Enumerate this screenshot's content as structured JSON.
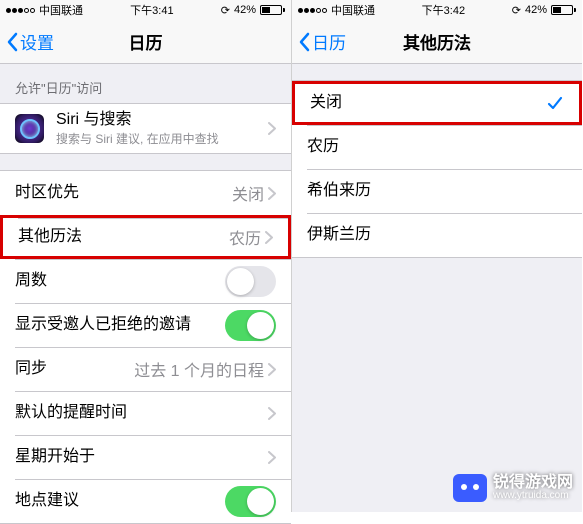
{
  "left": {
    "status": {
      "carrier": "中国联通",
      "time": "下午3:41",
      "battery": "42%"
    },
    "nav": {
      "back": "设置",
      "title": "日历"
    },
    "sectionHeader": "允许\"日历\"访问",
    "siri": {
      "title": "Siri 与搜索",
      "sub": "搜索与 Siri 建议, 在应用中查找"
    },
    "rows": {
      "tzOverride": {
        "label": "时区优先",
        "value": "关闭"
      },
      "altCal": {
        "label": "其他历法",
        "value": "农历"
      },
      "weekNum": {
        "label": "周数"
      },
      "declined": {
        "label": "显示受邀人已拒绝的邀请"
      },
      "sync": {
        "label": "同步",
        "value": "过去 1 个月的日程"
      },
      "alertTime": {
        "label": "默认的提醒时间"
      },
      "weekStart": {
        "label": "星期开始于"
      },
      "location": {
        "label": "地点建议"
      }
    }
  },
  "right": {
    "status": {
      "carrier": "中国联通",
      "time": "下午3:42",
      "battery": "42%"
    },
    "nav": {
      "back": "日历",
      "title": "其他历法"
    },
    "options": {
      "off": "关闭",
      "lunar": "农历",
      "hebrew": "希伯来历",
      "islamic": "伊斯兰历"
    }
  },
  "watermark": {
    "name": "锐得游戏网",
    "url": "www.ytruida.com"
  }
}
